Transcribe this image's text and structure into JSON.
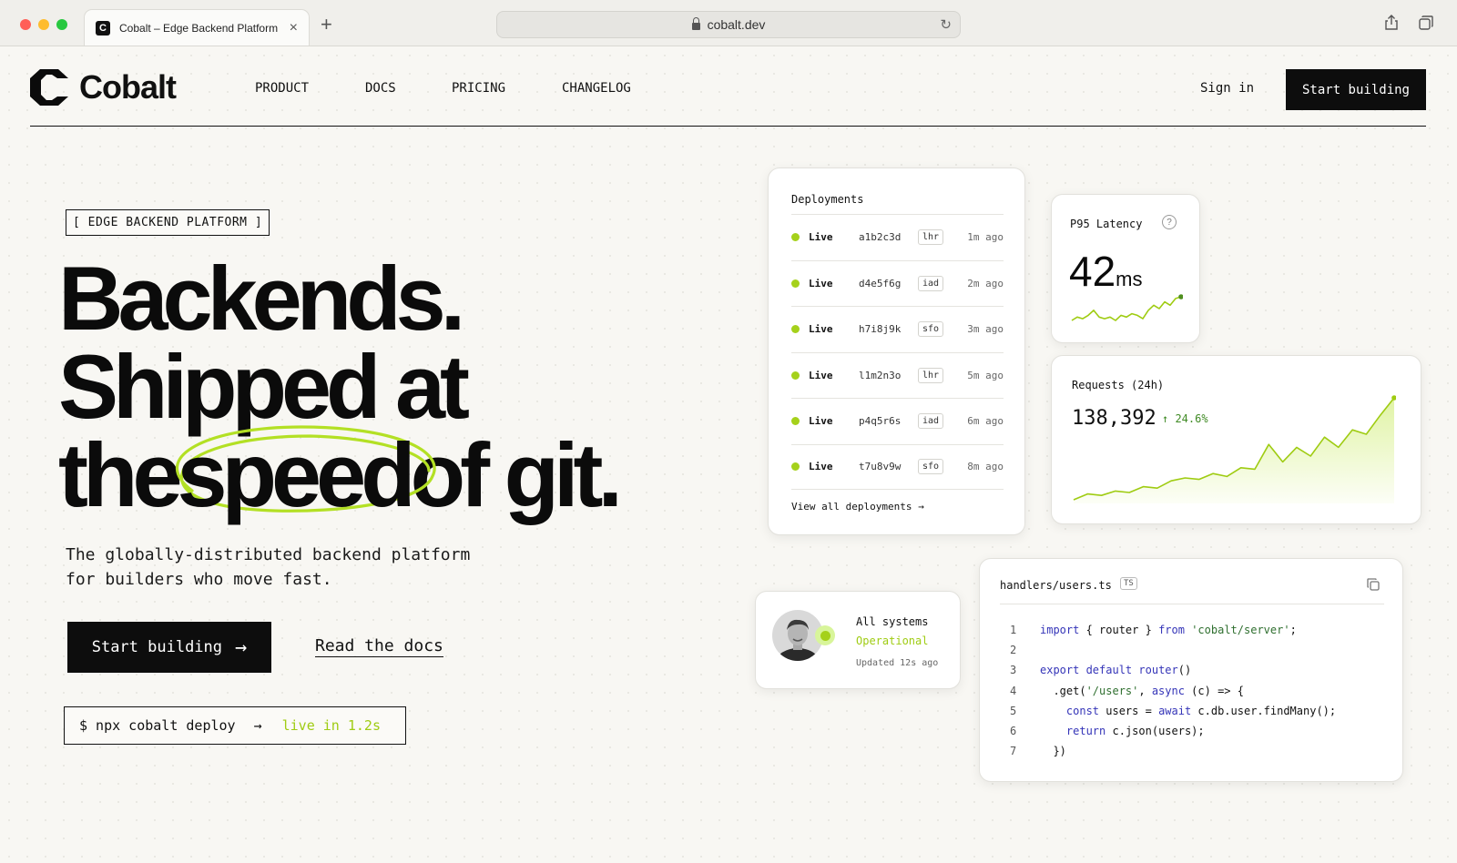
{
  "browser": {
    "tab_title": "Cobalt – Edge Backend Platform",
    "url": "cobalt.dev"
  },
  "nav": {
    "logo_text": "Cobalt",
    "product": "PRODUCT",
    "docs": "DOCS",
    "pricing": "PRICING",
    "changelog": "CHANGELOG",
    "sign_in": "Sign in",
    "cta": "Start building"
  },
  "hero": {
    "eyebrow": "[ EDGE BACKEND PLATFORM ]",
    "headline_line1": "Backends.",
    "headline_line2": "Shipped at",
    "headline_line3_pre": "the",
    "headline_highlight": "speed",
    "headline_line3_post": "of git.",
    "subhead_line1": "The globally-distributed backend platform",
    "subhead_line2": "for builders who move fast.",
    "cta_primary": "Start building",
    "cta_secondary": "Read the docs",
    "command": "$ npx cobalt deploy",
    "command_result": "live in 1.2s"
  },
  "deployments": {
    "title": "Deployments",
    "rows": [
      {
        "status": "Live",
        "hash": "a1b2c3d",
        "region": "lhr",
        "time": "1m ago"
      },
      {
        "status": "Live",
        "hash": "d4e5f6g",
        "region": "iad",
        "time": "2m ago"
      },
      {
        "status": "Live",
        "hash": "h7i8j9k",
        "region": "sfo",
        "time": "3m ago"
      },
      {
        "status": "Live",
        "hash": "l1m2n3o",
        "region": "lhr",
        "time": "5m ago"
      },
      {
        "status": "Live",
        "hash": "p4q5r6s",
        "region": "iad",
        "time": "6m ago"
      },
      {
        "status": "Live",
        "hash": "t7u8v9w",
        "region": "sfo",
        "time": "8m ago"
      }
    ],
    "view_all": "View all deployments"
  },
  "latency": {
    "title": "P95 Latency",
    "help": "?",
    "value": "42",
    "unit": "ms"
  },
  "requests": {
    "title": "Requests (24h)",
    "value": "138,392",
    "change": "↑ 24.6%"
  },
  "status": {
    "title": "All systems",
    "state": "Operational",
    "updated": "Updated 12s ago"
  },
  "code": {
    "filename": "handlers/users.ts",
    "badge": "TS",
    "lines": [
      {
        "n": "1"
      },
      {
        "n": "2"
      },
      {
        "n": "3"
      },
      {
        "n": "4"
      },
      {
        "n": "5"
      },
      {
        "n": "6"
      },
      {
        "n": "7"
      }
    ],
    "l1_import": "import",
    "l1_mid": " { router } ",
    "l1_from": "from",
    "l1_str": "'cobalt/server'",
    "l1_end": ";",
    "l3_export": "export default",
    "l3_fn": "router",
    "l3_end": "()",
    "l4_get": ".get(",
    "l4_str": "'/users'",
    "l4_mid": ", ",
    "l4_async": "async",
    "l4_end": " (c) => {",
    "l5_const": "const",
    "l5_mid": " users = ",
    "l5_await": "await",
    "l5_end": " c.db.user.findMany();",
    "l6_return": "return",
    "l6_end": " c.json(users);",
    "l7": "})"
  },
  "colors": {
    "accent": "#a5d11b",
    "dark": "#0d0d0d",
    "page_bg": "#f8f7f3"
  },
  "icons": {
    "lock": "lock-icon",
    "reload": "reload-icon",
    "share": "share-icon",
    "tabs": "tabs-icon",
    "copy": "copy-icon",
    "arrow": "arrow-right-icon"
  },
  "chart_data": [
    {
      "type": "line",
      "x": [
        0,
        1,
        2,
        3,
        4,
        5,
        6,
        7,
        8,
        9,
        10,
        11,
        12,
        13,
        14,
        15,
        16,
        17,
        18,
        19,
        20
      ],
      "values": [
        3,
        5,
        4,
        6,
        9,
        5,
        4,
        5,
        3,
        6,
        5,
        7,
        6,
        4,
        9,
        12,
        10,
        14,
        12,
        16,
        17
      ]
    },
    {
      "type": "area",
      "x": [
        0,
        1,
        2,
        3,
        4,
        5,
        6,
        7,
        8,
        9,
        10,
        11,
        12,
        13,
        14,
        15,
        16,
        17,
        18,
        19,
        20,
        21,
        22,
        23
      ],
      "values": [
        2,
        6,
        5,
        8,
        7,
        11,
        10,
        15,
        17,
        16,
        20,
        18,
        24,
        23,
        40,
        28,
        38,
        32,
        45,
        38,
        50,
        47,
        60,
        72
      ]
    }
  ]
}
